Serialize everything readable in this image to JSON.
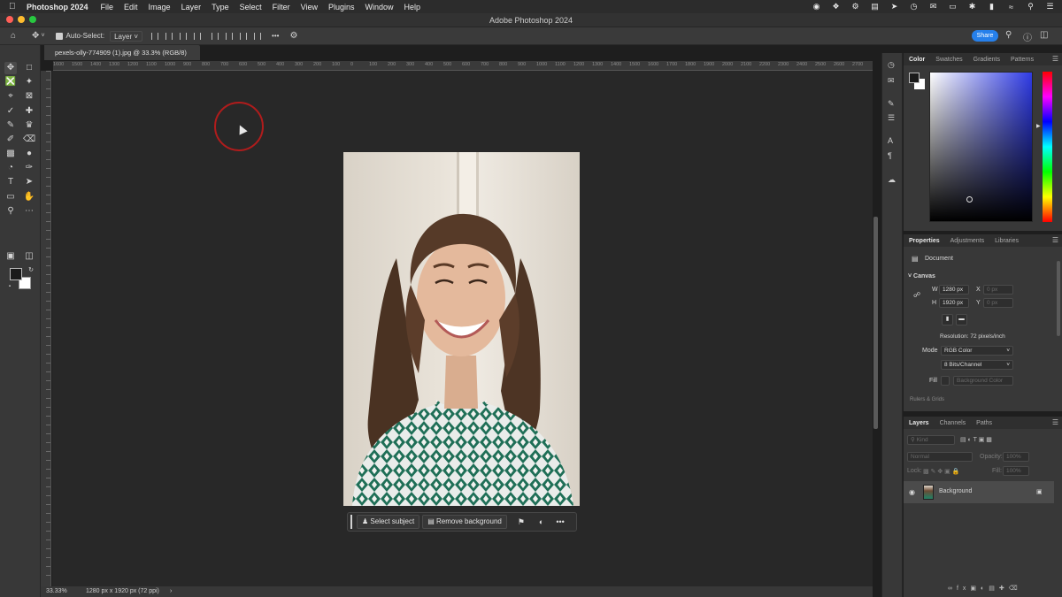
{
  "menubar": {
    "app_name": "Photoshop 2024",
    "items": [
      "File",
      "Edit",
      "Image",
      "Layer",
      "Type",
      "Select",
      "Filter",
      "View",
      "Plugins",
      "Window",
      "Help"
    ]
  },
  "window": {
    "title": "Adobe Photoshop 2024"
  },
  "options_bar": {
    "auto_select_label": "Auto-Select:",
    "auto_select_target": "Layer",
    "more_label": "•••",
    "share_label": "Share"
  },
  "document": {
    "tab_title": "pexels-olly-774909 (1).jpg @ 33.3% (RGB/8)",
    "ruler_labels": [
      "1600",
      "1500",
      "1400",
      "1300",
      "1200",
      "1100",
      "1000",
      "900",
      "800",
      "700",
      "600",
      "500",
      "400",
      "300",
      "200",
      "100",
      "0",
      "100",
      "200",
      "300",
      "400",
      "500",
      "600",
      "700",
      "800",
      "900",
      "1000",
      "1100",
      "1200",
      "1300",
      "1400",
      "1500",
      "1600",
      "1700",
      "1800",
      "1900",
      "2000",
      "2100",
      "2200",
      "2300",
      "2400",
      "2500",
      "2600",
      "2700"
    ]
  },
  "contextual_taskbar": {
    "select_subject_label": "Select subject",
    "remove_background_label": "Remove background",
    "more_label": "•••"
  },
  "status": {
    "zoom": "33.33%",
    "info": "1280 px x 1920 px (72 ppi)",
    "arrow": "›"
  },
  "color_panel": {
    "tabs": [
      "Color",
      "Swatches",
      "Gradients",
      "Patterns"
    ],
    "foreground": "#1a1a1a",
    "background": "#ffffff"
  },
  "properties_panel": {
    "tabs": [
      "Properties",
      "Adjustments",
      "Libraries"
    ],
    "document_label": "Document",
    "canvas_label": "Canvas",
    "w_label": "W",
    "w_value": "1280 px",
    "h_label": "H",
    "h_value": "1920 px",
    "x_label": "X",
    "x_value": "0 px",
    "y_label": "Y",
    "y_value": "0 px",
    "resolution": "Resolution: 72 pixels/inch",
    "mode_label": "Mode",
    "mode_value": "RGB Color",
    "depth_value": "8 Bits/Channel",
    "fill_label": "Fill",
    "fill_value": "Background Color",
    "rulers_grids_label": "Rulers & Grids"
  },
  "layers_panel": {
    "tabs": [
      "Layers",
      "Channels",
      "Paths"
    ],
    "kind_placeholder": "Kind",
    "blend_mode": "Normal",
    "opacity_label": "Opacity:",
    "opacity_value": "100%",
    "lock_label": "Lock:",
    "fill_label": "Fill:",
    "fill_value": "100%",
    "layer_name": "Background"
  },
  "colors": {
    "accent": "#2680eb",
    "cursor_highlight": "#b01c1c"
  }
}
